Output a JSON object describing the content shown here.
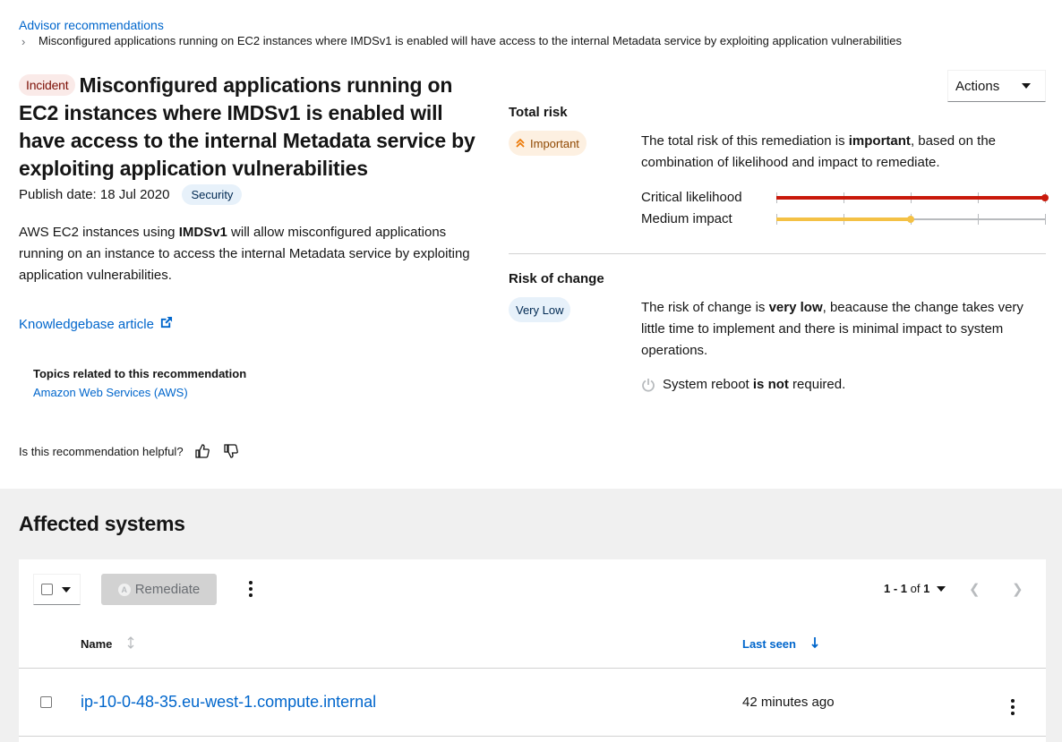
{
  "breadcrumb": {
    "root": "Advisor recommendations",
    "current": "Misconfigured applications running on EC2 instances where IMDSv1 is enabled will have access to the internal Metadata service by exploiting application vulnerabilities"
  },
  "recommendation": {
    "badge": "Incident",
    "title": "Misconfigured applications running on EC2 instances where IMDSv1 is enabled will have access to the internal Metadata service by exploiting application vulnerabilities",
    "publish_label": "Publish date: 18 Jul 2020",
    "category_badge": "Security",
    "description_pre": "AWS EC2 instances using ",
    "description_bold": "IMDSv1",
    "description_post": " will allow misconfigured applications running on an instance to access the internal Metadata service by exploiting application vulnerabilities.",
    "kb_link": "Knowledgebase article",
    "topics_title": "Topics related to this recommendation",
    "topics": [
      "Amazon Web Services (AWS)"
    ],
    "helpful_question": "Is this recommendation helpful?"
  },
  "actions": {
    "label": "Actions"
  },
  "total_risk": {
    "title": "Total risk",
    "badge": "Important",
    "text_pre": "The total risk of this remediation is ",
    "text_bold": "important",
    "text_post": ", based on the combination of likelihood and impact to remediate.",
    "likelihood_label": "Critical likelihood",
    "likelihood_level": 4,
    "impact_label": "Medium impact",
    "impact_level": 2,
    "max_level": 4,
    "likelihood_color": "#c9190b",
    "impact_color": "#f4c145"
  },
  "risk_of_change": {
    "title": "Risk of change",
    "badge": "Very Low",
    "text_pre": "The risk of change is ",
    "text_bold": "very low",
    "text_post": ", beacause the change takes very little time to implement and there is minimal impact to system operations.",
    "reboot_pre": "System reboot ",
    "reboot_bold": "is not",
    "reboot_post": " required."
  },
  "affected": {
    "title": "Affected systems",
    "remediate_label": "Remediate",
    "pagination_range": "1 - 1",
    "pagination_of": "of",
    "pagination_total": "1",
    "columns": [
      "Name",
      "Last seen"
    ],
    "rows": [
      {
        "name": "ip-10-0-48-35.eu-west-1.compute.internal",
        "last_seen": "42 minutes ago"
      }
    ]
  },
  "colors": {
    "link": "#0066cc",
    "incident_bg": "#faeae8",
    "important_bg": "#fdf0e1",
    "low_bg": "#e7f1fa"
  }
}
